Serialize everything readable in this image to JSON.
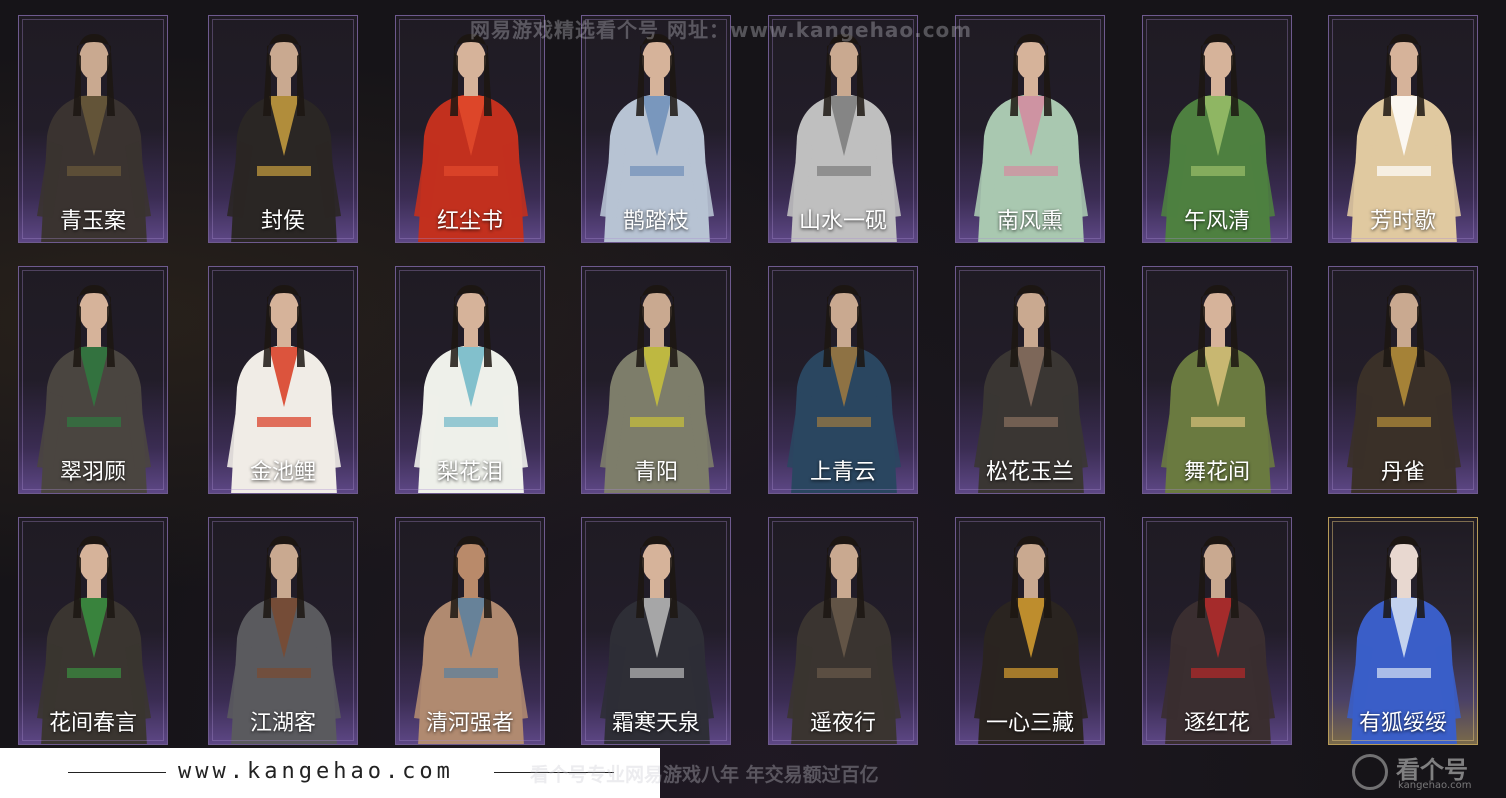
{
  "watermark_top": "网易游戏精选看个号  网址：www.kangehao.com",
  "cards": [
    {
      "name": "青玉案",
      "robe": "#3a3330",
      "accent": "#6b5a3a",
      "skin": "#c9a990"
    },
    {
      "name": "封侯",
      "robe": "#2a2624",
      "accent": "#c9a040",
      "skin": "#c9a990"
    },
    {
      "name": "红尘书",
      "robe": "#c2301e",
      "accent": "#e24a2c",
      "skin": "#d6b39a"
    },
    {
      "name": "鹊踏枝",
      "robe": "#b7c3d3",
      "accent": "#6f8fb8",
      "skin": "#d6b39a"
    },
    {
      "name": "山水一砚",
      "robe": "#bfbfbf",
      "accent": "#7a7a7a",
      "skin": "#c9a990"
    },
    {
      "name": "南风熏",
      "robe": "#a9c8b0",
      "accent": "#d58aa0",
      "skin": "#d6b39a"
    },
    {
      "name": "午风清",
      "robe": "#4e8040",
      "accent": "#9bbf6a",
      "skin": "#d6b39a"
    },
    {
      "name": "芳时歇",
      "robe": "#e0c9a0",
      "accent": "#ffffff",
      "skin": "#d6b39a"
    },
    {
      "name": "翠羽顾",
      "robe": "#4a4540",
      "accent": "#2f7a40",
      "skin": "#d6b39a"
    },
    {
      "name": "金池鲤",
      "robe": "#f0ece6",
      "accent": "#d8391f",
      "skin": "#d6b39a"
    },
    {
      "name": "梨花泪",
      "robe": "#eef0ea",
      "accent": "#6fb7c7",
      "skin": "#d6b39a"
    },
    {
      "name": "青阳",
      "robe": "#7d7d6a",
      "accent": "#c9c23a",
      "skin": "#c9a990"
    },
    {
      "name": "上青云",
      "robe": "#2a4660",
      "accent": "#a07a40",
      "skin": "#c9a990"
    },
    {
      "name": "松花玉兰",
      "robe": "#3a3633",
      "accent": "#8a7060",
      "skin": "#c9a990"
    },
    {
      "name": "舞花间",
      "robe": "#6a7a40",
      "accent": "#d8c27a",
      "skin": "#d6b39a"
    },
    {
      "name": "丹雀",
      "robe": "#3a3028",
      "accent": "#b8903a",
      "skin": "#c9a990"
    },
    {
      "name": "花间春言",
      "robe": "#3a3530",
      "accent": "#3a9040",
      "skin": "#d6b39a"
    },
    {
      "name": "江湖客",
      "robe": "#5a5a5e",
      "accent": "#7a4a30",
      "skin": "#c9a990"
    },
    {
      "name": "清河强者",
      "robe": "#b08a70",
      "accent": "#5a80a0",
      "skin": "#b98a6a"
    },
    {
      "name": "霜寒天泉",
      "robe": "#2e2e36",
      "accent": "#bbbbbb",
      "skin": "#d6b39a"
    },
    {
      "name": "遥夜行",
      "robe": "#3a3430",
      "accent": "#6a5a4a",
      "skin": "#c9a990"
    },
    {
      "name": "一心三藏",
      "robe": "#2a2420",
      "accent": "#d8a030",
      "skin": "#c9a990"
    },
    {
      "name": "逐红花",
      "robe": "#3a2e30",
      "accent": "#b82a2a",
      "skin": "#c9a990"
    },
    {
      "name": "有狐绥绥",
      "robe": "#3a5ec8",
      "accent": "#dce6f5",
      "skin": "#e8d8d0"
    }
  ],
  "footer": {
    "site": "www.kangehao.com",
    "slogan": "看个号专业网易游戏八年  年交易额过百亿",
    "logo_text": "看个号",
    "logo_sub": "kangehao.com"
  }
}
